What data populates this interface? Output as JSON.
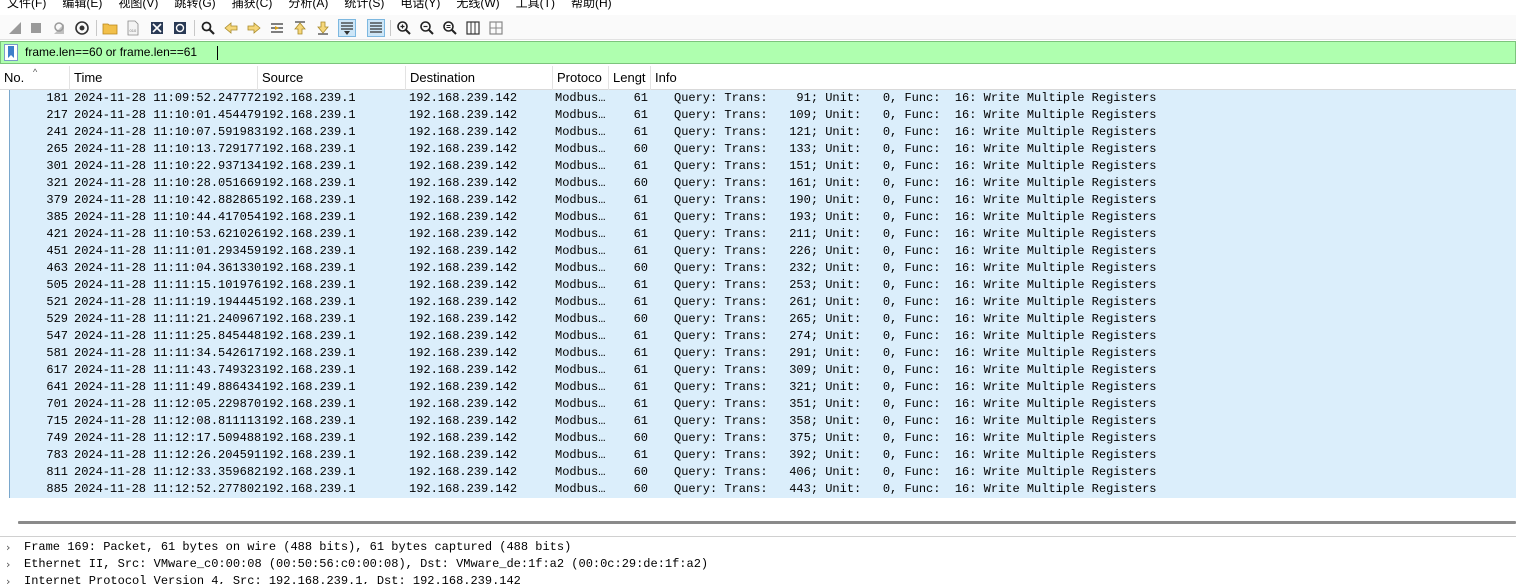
{
  "menu": [
    "文件(F)",
    "编辑(E)",
    "视图(V)",
    "跳转(G)",
    "捕获(C)",
    "分析(A)",
    "统计(S)",
    "电话(Y)",
    "无线(W)",
    "工具(T)",
    "帮助(H)"
  ],
  "toolbar": {
    "icons": [
      "shark-fin-start-icon",
      "stop-square-icon",
      "restart-fin-icon",
      "capture-options-gear-icon",
      "open-folder-icon",
      "save-file-icon",
      "close-file-icon",
      "reload-file-icon",
      "find-packet-icon",
      "go-back-arrow-icon",
      "go-forward-arrow-icon",
      "go-to-packet-icon",
      "go-first-icon",
      "go-last-icon",
      "autoscroll-icon",
      "colorize-icon",
      "zoom-in-icon",
      "zoom-out-icon",
      "zoom-normal-icon",
      "resize-columns-icon",
      "layout-icon"
    ]
  },
  "filter": {
    "value": "frame.len==60 or frame.len==61",
    "color": "#afffaf"
  },
  "columns": {
    "no": "No.",
    "time": "Time",
    "source": "Source",
    "destination": "Destination",
    "protocol": "Protoco",
    "length": "Lengt",
    "info": "Info"
  },
  "packets": [
    {
      "no": "181",
      "time": "2024-11-28 11:09:52.247772",
      "src": "192.168.239.1",
      "dst": "192.168.239.142",
      "proto": "Modbus…",
      "len": "61",
      "info": "Query: Trans:    91; Unit:   0, Func:  16: Write Multiple Registers"
    },
    {
      "no": "217",
      "time": "2024-11-28 11:10:01.454479",
      "src": "192.168.239.1",
      "dst": "192.168.239.142",
      "proto": "Modbus…",
      "len": "61",
      "info": "Query: Trans:   109; Unit:   0, Func:  16: Write Multiple Registers"
    },
    {
      "no": "241",
      "time": "2024-11-28 11:10:07.591983",
      "src": "192.168.239.1",
      "dst": "192.168.239.142",
      "proto": "Modbus…",
      "len": "61",
      "info": "Query: Trans:   121; Unit:   0, Func:  16: Write Multiple Registers"
    },
    {
      "no": "265",
      "time": "2024-11-28 11:10:13.729177",
      "src": "192.168.239.1",
      "dst": "192.168.239.142",
      "proto": "Modbus…",
      "len": "60",
      "info": "Query: Trans:   133; Unit:   0, Func:  16: Write Multiple Registers"
    },
    {
      "no": "301",
      "time": "2024-11-28 11:10:22.937134",
      "src": "192.168.239.1",
      "dst": "192.168.239.142",
      "proto": "Modbus…",
      "len": "61",
      "info": "Query: Trans:   151; Unit:   0, Func:  16: Write Multiple Registers"
    },
    {
      "no": "321",
      "time": "2024-11-28 11:10:28.051669",
      "src": "192.168.239.1",
      "dst": "192.168.239.142",
      "proto": "Modbus…",
      "len": "60",
      "info": "Query: Trans:   161; Unit:   0, Func:  16: Write Multiple Registers"
    },
    {
      "no": "379",
      "time": "2024-11-28 11:10:42.882865",
      "src": "192.168.239.1",
      "dst": "192.168.239.142",
      "proto": "Modbus…",
      "len": "61",
      "info": "Query: Trans:   190; Unit:   0, Func:  16: Write Multiple Registers"
    },
    {
      "no": "385",
      "time": "2024-11-28 11:10:44.417054",
      "src": "192.168.239.1",
      "dst": "192.168.239.142",
      "proto": "Modbus…",
      "len": "61",
      "info": "Query: Trans:   193; Unit:   0, Func:  16: Write Multiple Registers"
    },
    {
      "no": "421",
      "time": "2024-11-28 11:10:53.621026",
      "src": "192.168.239.1",
      "dst": "192.168.239.142",
      "proto": "Modbus…",
      "len": "61",
      "info": "Query: Trans:   211; Unit:   0, Func:  16: Write Multiple Registers"
    },
    {
      "no": "451",
      "time": "2024-11-28 11:11:01.293459",
      "src": "192.168.239.1",
      "dst": "192.168.239.142",
      "proto": "Modbus…",
      "len": "61",
      "info": "Query: Trans:   226; Unit:   0, Func:  16: Write Multiple Registers"
    },
    {
      "no": "463",
      "time": "2024-11-28 11:11:04.361330",
      "src": "192.168.239.1",
      "dst": "192.168.239.142",
      "proto": "Modbus…",
      "len": "60",
      "info": "Query: Trans:   232; Unit:   0, Func:  16: Write Multiple Registers"
    },
    {
      "no": "505",
      "time": "2024-11-28 11:11:15.101976",
      "src": "192.168.239.1",
      "dst": "192.168.239.142",
      "proto": "Modbus…",
      "len": "61",
      "info": "Query: Trans:   253; Unit:   0, Func:  16: Write Multiple Registers"
    },
    {
      "no": "521",
      "time": "2024-11-28 11:11:19.194445",
      "src": "192.168.239.1",
      "dst": "192.168.239.142",
      "proto": "Modbus…",
      "len": "61",
      "info": "Query: Trans:   261; Unit:   0, Func:  16: Write Multiple Registers"
    },
    {
      "no": "529",
      "time": "2024-11-28 11:11:21.240967",
      "src": "192.168.239.1",
      "dst": "192.168.239.142",
      "proto": "Modbus…",
      "len": "60",
      "info": "Query: Trans:   265; Unit:   0, Func:  16: Write Multiple Registers"
    },
    {
      "no": "547",
      "time": "2024-11-28 11:11:25.845448",
      "src": "192.168.239.1",
      "dst": "192.168.239.142",
      "proto": "Modbus…",
      "len": "61",
      "info": "Query: Trans:   274; Unit:   0, Func:  16: Write Multiple Registers"
    },
    {
      "no": "581",
      "time": "2024-11-28 11:11:34.542617",
      "src": "192.168.239.1",
      "dst": "192.168.239.142",
      "proto": "Modbus…",
      "len": "61",
      "info": "Query: Trans:   291; Unit:   0, Func:  16: Write Multiple Registers"
    },
    {
      "no": "617",
      "time": "2024-11-28 11:11:43.749323",
      "src": "192.168.239.1",
      "dst": "192.168.239.142",
      "proto": "Modbus…",
      "len": "61",
      "info": "Query: Trans:   309; Unit:   0, Func:  16: Write Multiple Registers"
    },
    {
      "no": "641",
      "time": "2024-11-28 11:11:49.886434",
      "src": "192.168.239.1",
      "dst": "192.168.239.142",
      "proto": "Modbus…",
      "len": "61",
      "info": "Query: Trans:   321; Unit:   0, Func:  16: Write Multiple Registers"
    },
    {
      "no": "701",
      "time": "2024-11-28 11:12:05.229870",
      "src": "192.168.239.1",
      "dst": "192.168.239.142",
      "proto": "Modbus…",
      "len": "61",
      "info": "Query: Trans:   351; Unit:   0, Func:  16: Write Multiple Registers"
    },
    {
      "no": "715",
      "time": "2024-11-28 11:12:08.811113",
      "src": "192.168.239.1",
      "dst": "192.168.239.142",
      "proto": "Modbus…",
      "len": "61",
      "info": "Query: Trans:   358; Unit:   0, Func:  16: Write Multiple Registers"
    },
    {
      "no": "749",
      "time": "2024-11-28 11:12:17.509488",
      "src": "192.168.239.1",
      "dst": "192.168.239.142",
      "proto": "Modbus…",
      "len": "60",
      "info": "Query: Trans:   375; Unit:   0, Func:  16: Write Multiple Registers"
    },
    {
      "no": "783",
      "time": "2024-11-28 11:12:26.204591",
      "src": "192.168.239.1",
      "dst": "192.168.239.142",
      "proto": "Modbus…",
      "len": "61",
      "info": "Query: Trans:   392; Unit:   0, Func:  16: Write Multiple Registers"
    },
    {
      "no": "811",
      "time": "2024-11-28 11:12:33.359682",
      "src": "192.168.239.1",
      "dst": "192.168.239.142",
      "proto": "Modbus…",
      "len": "60",
      "info": "Query: Trans:   406; Unit:   0, Func:  16: Write Multiple Registers"
    },
    {
      "no": "885",
      "time": "2024-11-28 11:12:52.277802",
      "src": "192.168.239.1",
      "dst": "192.168.239.142",
      "proto": "Modbus…",
      "len": "60",
      "info": "Query: Trans:   443; Unit:   0, Func:  16: Write Multiple Registers"
    }
  ],
  "details": [
    {
      "arrow": "›",
      "text": "Frame 169: Packet, 61 bytes on wire (488 bits), 61 bytes captured (488 bits)"
    },
    {
      "arrow": "›",
      "text": "Ethernet II, Src: VMware_c0:00:08 (00:50:56:c0:00:08), Dst: VMware_de:1f:a2 (00:0c:29:de:1f:a2)"
    },
    {
      "arrow": "›",
      "text": "Internet Protocol Version 4, Src: 192.168.239.1, Dst: 192.168.239.142"
    }
  ],
  "colors": {
    "row_background": "#dbeefb",
    "filter_valid": "#afffaf"
  }
}
